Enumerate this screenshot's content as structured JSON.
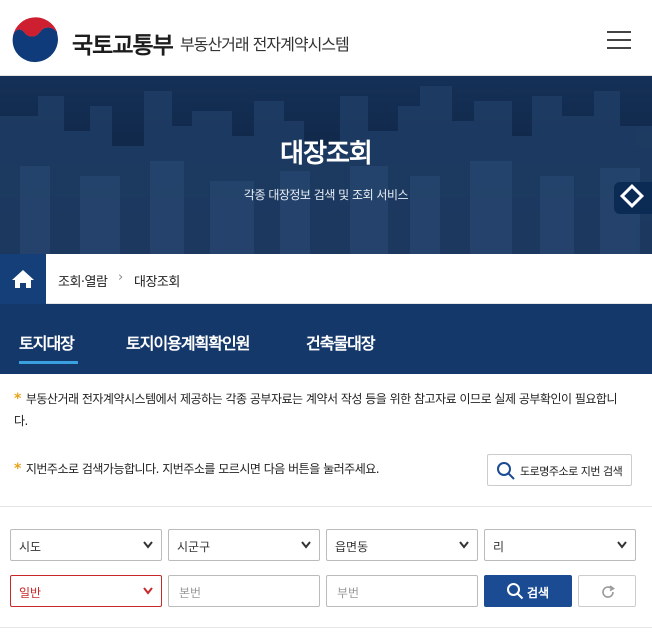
{
  "header": {
    "ministry": "국토교통부",
    "system": "부동산거래 전자계약시스템",
    "menu_icon": "hamburger-menu-icon"
  },
  "hero": {
    "title": "대장조회",
    "subtitle": "각종 대장정보 검색 및 조회 서비스"
  },
  "breadcrumb": {
    "home_icon": "home-icon",
    "items": [
      "조회·열람",
      "대장조회"
    ]
  },
  "tabs": [
    {
      "label": "토지대장",
      "active": true
    },
    {
      "label": "토지이용계획확인원",
      "active": false
    },
    {
      "label": "건축물대장",
      "active": false
    }
  ],
  "notices": [
    {
      "mark": "*",
      "line1": "부동산거래 전자계약시스템에서 제공하는 각종 공부자료는 계약서 작성 등을 위한 참고자료 이므로 실제 공부확인이 필요합니",
      "line2": "다."
    },
    {
      "mark": "*",
      "line1": "지번주소로 검색가능합니다. 지번주소를 모르시면 다음 버튼을 눌러주세요."
    }
  ],
  "road_search_button": "도로명주소로 지번 검색",
  "form": {
    "sido": "시도",
    "sigungu": "시군구",
    "eupmyeondong": "읍면동",
    "ri": "리",
    "land_type": "일반",
    "bonbun_placeholder": "본번",
    "bubun_placeholder": "부번",
    "search_label": "검색"
  },
  "colors": {
    "navy": "#15386b",
    "button_blue": "#1a4b93",
    "accent_star": "#e8a31a",
    "tab_underline": "#3aa0e0",
    "alert_red": "#c82828"
  }
}
